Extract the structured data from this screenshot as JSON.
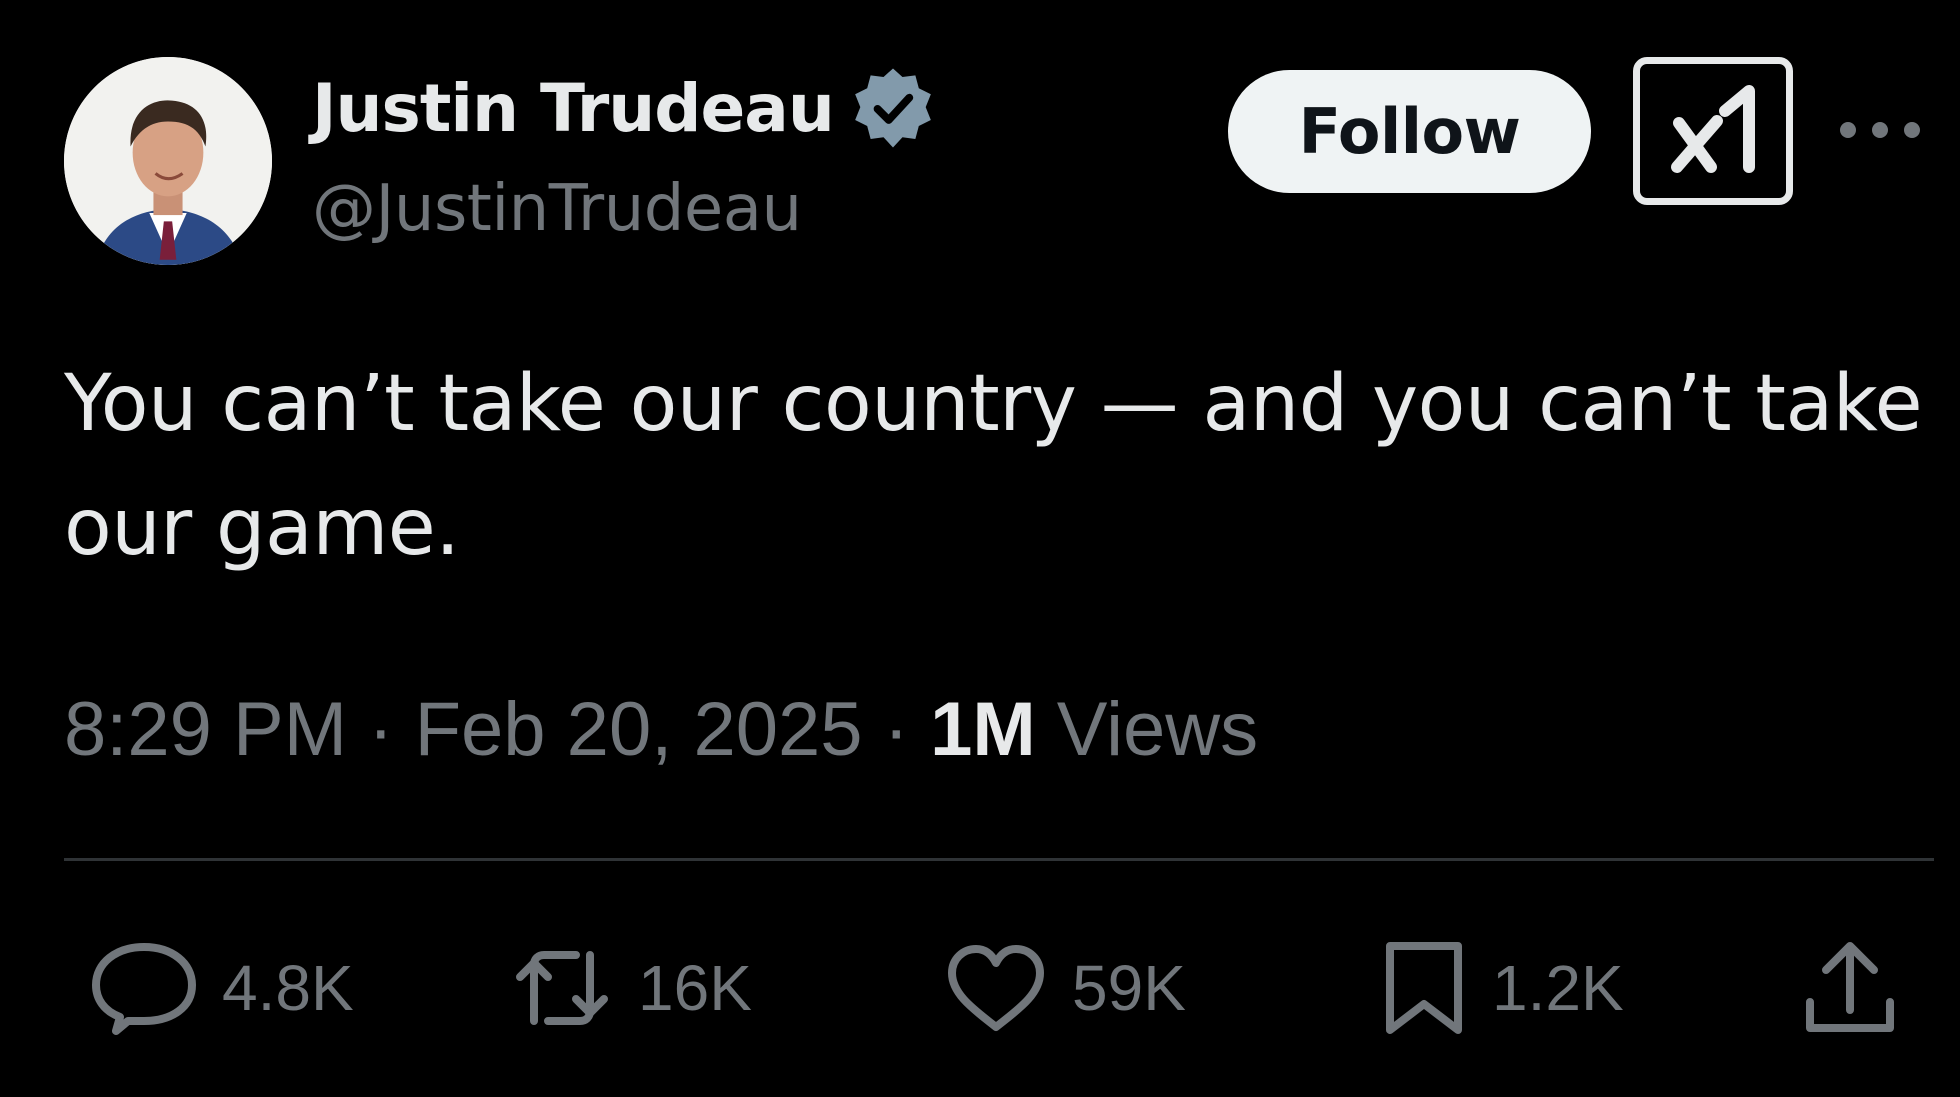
{
  "author": {
    "display_name": "Justin Trudeau",
    "handle": "@JustinTrudeau",
    "verified_color": "#829aab",
    "avatar_icon": "profile-photo"
  },
  "header": {
    "follow_label": "Follow",
    "grok_icon": "grok-icon",
    "more_icon": "more-dots-icon"
  },
  "tweet": {
    "text": "You can’t take our country — and you can’t take our game.",
    "time": "8:29 PM",
    "separator": "·",
    "date": "Feb 20, 2025",
    "views_count": "1M",
    "views_label": "Views"
  },
  "actions": {
    "reply": {
      "icon": "reply-icon",
      "count": "4.8K"
    },
    "repost": {
      "icon": "repost-icon",
      "count": "16K"
    },
    "like": {
      "icon": "heart-icon",
      "count": "59K"
    },
    "bookmark": {
      "icon": "bookmark-icon",
      "count": "1.2K"
    },
    "share": {
      "icon": "share-icon"
    }
  },
  "colors": {
    "background": "#000000",
    "primary_text": "#e7e9ea",
    "secondary_text": "#71767b",
    "divider": "#2f3336",
    "follow_bg": "#eff3f4"
  }
}
